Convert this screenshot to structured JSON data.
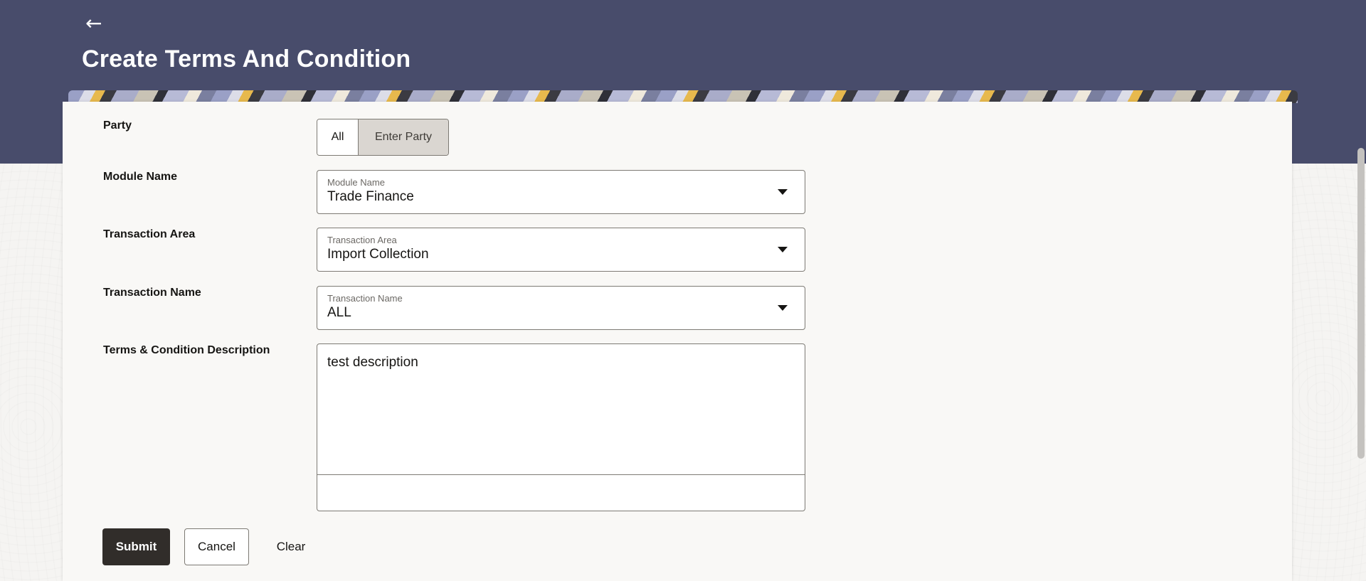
{
  "header": {
    "back_icon": "←",
    "title": "Create Terms And Condition"
  },
  "form": {
    "party": {
      "label": "Party",
      "options": [
        "All",
        "Enter Party"
      ],
      "selected": "Enter Party"
    },
    "module_name": {
      "label": "Module Name",
      "field_label": "Module Name",
      "value": "Trade Finance"
    },
    "transaction_area": {
      "label": "Transaction Area",
      "field_label": "Transaction Area",
      "value": "Import Collection"
    },
    "transaction_name": {
      "label": "Transaction Name",
      "field_label": "Transaction Name",
      "value": "ALL"
    },
    "description": {
      "label": "Terms & Condition Description",
      "value": "test description"
    }
  },
  "actions": {
    "submit": "Submit",
    "cancel": "Cancel",
    "clear": "Clear"
  },
  "colors": {
    "header": "#484c6b",
    "primary_button": "#312d2a",
    "card": "#f9f8f6"
  }
}
